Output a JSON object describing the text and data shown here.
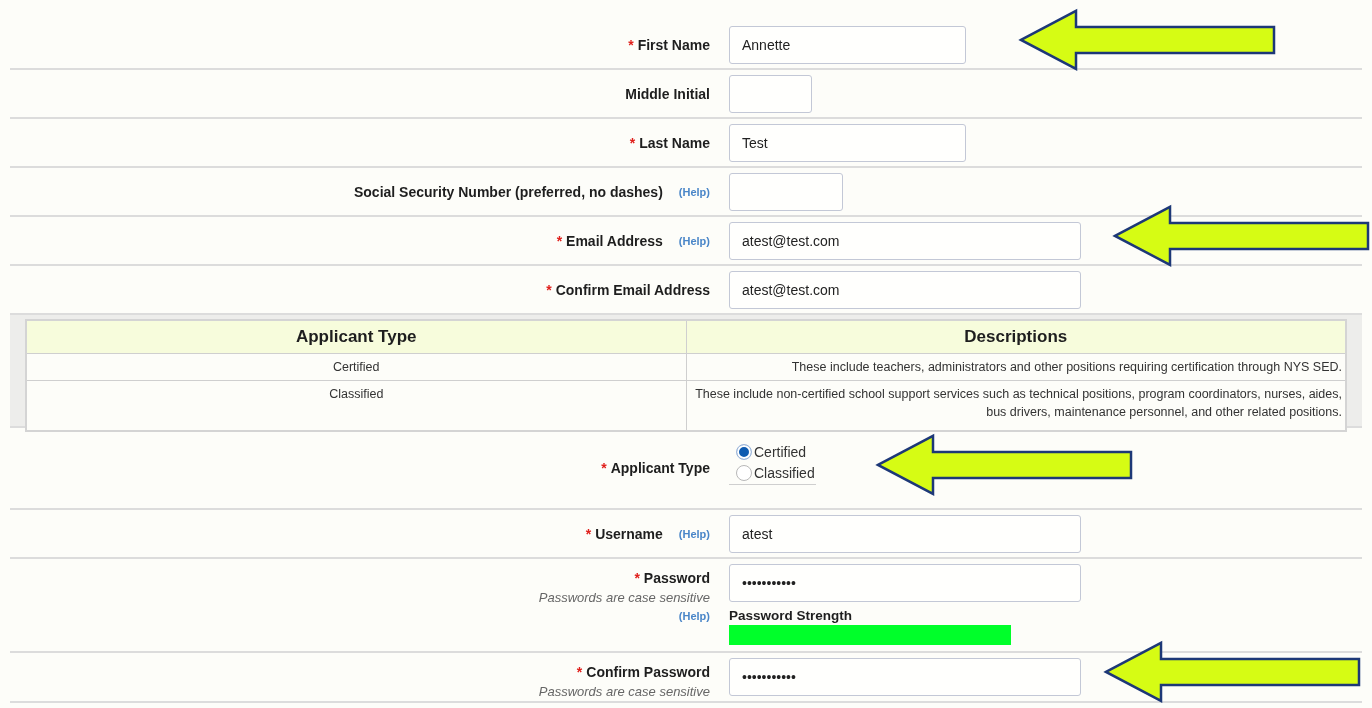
{
  "form": {
    "rows": [
      {
        "kind": "text",
        "required_mark": "*",
        "label": "First Name",
        "value": "Annette",
        "arrow": true
      },
      {
        "kind": "text",
        "label": "Middle Initial",
        "arrow": false
      },
      {
        "kind": "text",
        "required_mark": "*",
        "label": "Last Name",
        "value": "Test",
        "arrow": false
      },
      {
        "kind": "text",
        "label": "Social Security Number (preferred, no dashes)",
        "help": "(Help)",
        "arrow": false
      },
      {
        "kind": "text",
        "required_mark": "*",
        "label": "Email Address",
        "help": "(Help)",
        "value": "atest@test.com",
        "arrow": true
      },
      {
        "kind": "text",
        "required_mark": "*",
        "label": "Confirm Email Address",
        "value": "atest@test.com",
        "arrow": false
      },
      {
        "kind": "table",
        "columns": [
          "Applicant Type",
          "Descriptions"
        ],
        "rows": [
          [
            "Certified",
            "These include teachers, administrators and other positions requiring certification through NYS SED."
          ],
          [
            "Classified",
            "These include non-certified school support services such as technical positions, program coordinators, nurses, aides, bus drivers, maintenance personnel, and other related positions."
          ]
        ]
      },
      {
        "kind": "radio",
        "required_mark": "*",
        "label": "Applicant Type",
        "options": [
          {
            "label": "Certified",
            "selected": true
          },
          {
            "label": "Classified",
            "selected": false
          }
        ],
        "arrow": true
      },
      {
        "kind": "text",
        "required_mark": "*",
        "label": "Username",
        "help": "(Help)",
        "value": "atest",
        "arrow": false
      },
      {
        "kind": "password",
        "required_mark": "*",
        "label": "Password",
        "note": "Passwords are case sensitive",
        "help": "(Help)",
        "value": "•••••••••••",
        "strength": {
          "label": "Password Strength",
          "level": 1
        },
        "arrow": false
      },
      {
        "kind": "password",
        "required_mark": "*",
        "label": "Confirm Password",
        "note": "Passwords are case sensitive",
        "value": "•••••••••••",
        "arrow": true
      }
    ]
  }
}
